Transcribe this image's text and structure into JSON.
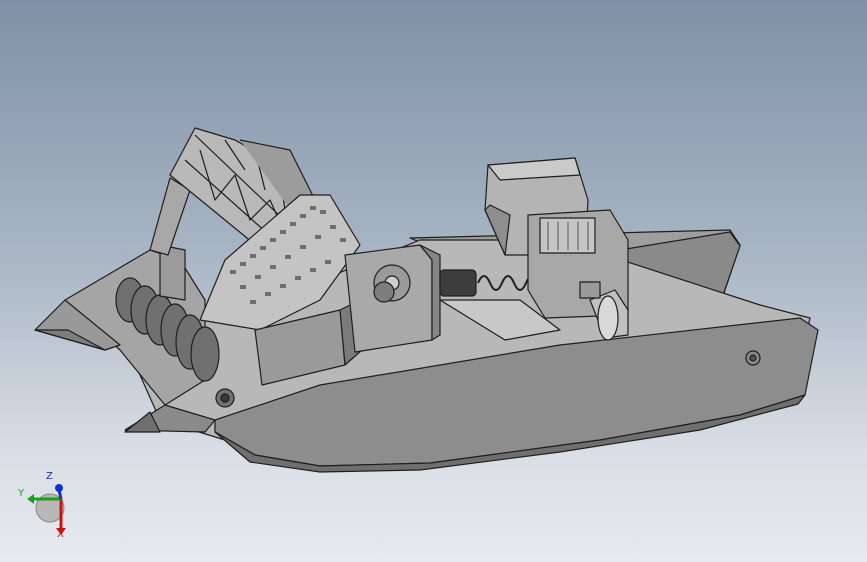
{
  "viewport": {
    "background_top": "#7f91a6",
    "background_bottom": "#e7eaee"
  },
  "model": {
    "icon": "boat-3d-model",
    "shade_light": "#bdbdbd",
    "shade_mid": "#9a9a9a",
    "shade_dark": "#6f6f6f",
    "edge": "#1e1e1e"
  },
  "triad": {
    "x_label": "X",
    "y_label": "Y",
    "z_label": "Z",
    "x_color": "#d01010",
    "y_color": "#18a018",
    "z_color": "#1030d0"
  }
}
